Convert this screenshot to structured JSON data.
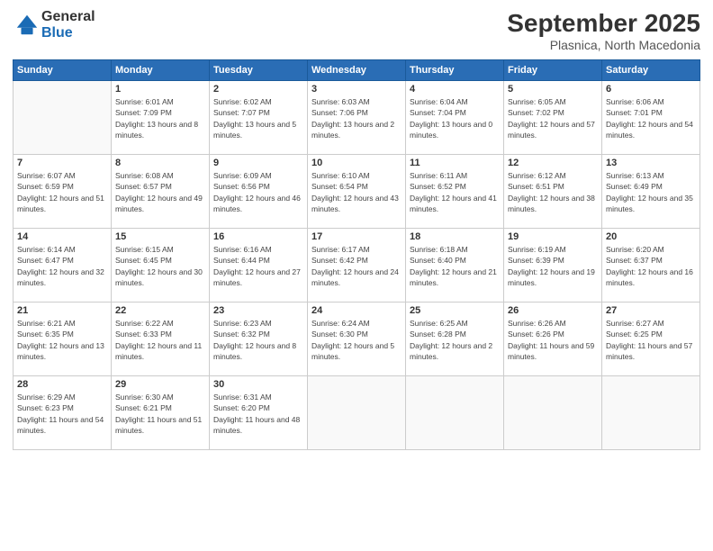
{
  "logo": {
    "general": "General",
    "blue": "Blue"
  },
  "header": {
    "month": "September 2025",
    "location": "Plasnica, North Macedonia"
  },
  "weekdays": [
    "Sunday",
    "Monday",
    "Tuesday",
    "Wednesday",
    "Thursday",
    "Friday",
    "Saturday"
  ],
  "weeks": [
    [
      {
        "day": "",
        "sunrise": "",
        "sunset": "",
        "daylight": ""
      },
      {
        "day": "1",
        "sunrise": "Sunrise: 6:01 AM",
        "sunset": "Sunset: 7:09 PM",
        "daylight": "Daylight: 13 hours and 8 minutes."
      },
      {
        "day": "2",
        "sunrise": "Sunrise: 6:02 AM",
        "sunset": "Sunset: 7:07 PM",
        "daylight": "Daylight: 13 hours and 5 minutes."
      },
      {
        "day": "3",
        "sunrise": "Sunrise: 6:03 AM",
        "sunset": "Sunset: 7:06 PM",
        "daylight": "Daylight: 13 hours and 2 minutes."
      },
      {
        "day": "4",
        "sunrise": "Sunrise: 6:04 AM",
        "sunset": "Sunset: 7:04 PM",
        "daylight": "Daylight: 13 hours and 0 minutes."
      },
      {
        "day": "5",
        "sunrise": "Sunrise: 6:05 AM",
        "sunset": "Sunset: 7:02 PM",
        "daylight": "Daylight: 12 hours and 57 minutes."
      },
      {
        "day": "6",
        "sunrise": "Sunrise: 6:06 AM",
        "sunset": "Sunset: 7:01 PM",
        "daylight": "Daylight: 12 hours and 54 minutes."
      }
    ],
    [
      {
        "day": "7",
        "sunrise": "Sunrise: 6:07 AM",
        "sunset": "Sunset: 6:59 PM",
        "daylight": "Daylight: 12 hours and 51 minutes."
      },
      {
        "day": "8",
        "sunrise": "Sunrise: 6:08 AM",
        "sunset": "Sunset: 6:57 PM",
        "daylight": "Daylight: 12 hours and 49 minutes."
      },
      {
        "day": "9",
        "sunrise": "Sunrise: 6:09 AM",
        "sunset": "Sunset: 6:56 PM",
        "daylight": "Daylight: 12 hours and 46 minutes."
      },
      {
        "day": "10",
        "sunrise": "Sunrise: 6:10 AM",
        "sunset": "Sunset: 6:54 PM",
        "daylight": "Daylight: 12 hours and 43 minutes."
      },
      {
        "day": "11",
        "sunrise": "Sunrise: 6:11 AM",
        "sunset": "Sunset: 6:52 PM",
        "daylight": "Daylight: 12 hours and 41 minutes."
      },
      {
        "day": "12",
        "sunrise": "Sunrise: 6:12 AM",
        "sunset": "Sunset: 6:51 PM",
        "daylight": "Daylight: 12 hours and 38 minutes."
      },
      {
        "day": "13",
        "sunrise": "Sunrise: 6:13 AM",
        "sunset": "Sunset: 6:49 PM",
        "daylight": "Daylight: 12 hours and 35 minutes."
      }
    ],
    [
      {
        "day": "14",
        "sunrise": "Sunrise: 6:14 AM",
        "sunset": "Sunset: 6:47 PM",
        "daylight": "Daylight: 12 hours and 32 minutes."
      },
      {
        "day": "15",
        "sunrise": "Sunrise: 6:15 AM",
        "sunset": "Sunset: 6:45 PM",
        "daylight": "Daylight: 12 hours and 30 minutes."
      },
      {
        "day": "16",
        "sunrise": "Sunrise: 6:16 AM",
        "sunset": "Sunset: 6:44 PM",
        "daylight": "Daylight: 12 hours and 27 minutes."
      },
      {
        "day": "17",
        "sunrise": "Sunrise: 6:17 AM",
        "sunset": "Sunset: 6:42 PM",
        "daylight": "Daylight: 12 hours and 24 minutes."
      },
      {
        "day": "18",
        "sunrise": "Sunrise: 6:18 AM",
        "sunset": "Sunset: 6:40 PM",
        "daylight": "Daylight: 12 hours and 21 minutes."
      },
      {
        "day": "19",
        "sunrise": "Sunrise: 6:19 AM",
        "sunset": "Sunset: 6:39 PM",
        "daylight": "Daylight: 12 hours and 19 minutes."
      },
      {
        "day": "20",
        "sunrise": "Sunrise: 6:20 AM",
        "sunset": "Sunset: 6:37 PM",
        "daylight": "Daylight: 12 hours and 16 minutes."
      }
    ],
    [
      {
        "day": "21",
        "sunrise": "Sunrise: 6:21 AM",
        "sunset": "Sunset: 6:35 PM",
        "daylight": "Daylight: 12 hours and 13 minutes."
      },
      {
        "day": "22",
        "sunrise": "Sunrise: 6:22 AM",
        "sunset": "Sunset: 6:33 PM",
        "daylight": "Daylight: 12 hours and 11 minutes."
      },
      {
        "day": "23",
        "sunrise": "Sunrise: 6:23 AM",
        "sunset": "Sunset: 6:32 PM",
        "daylight": "Daylight: 12 hours and 8 minutes."
      },
      {
        "day": "24",
        "sunrise": "Sunrise: 6:24 AM",
        "sunset": "Sunset: 6:30 PM",
        "daylight": "Daylight: 12 hours and 5 minutes."
      },
      {
        "day": "25",
        "sunrise": "Sunrise: 6:25 AM",
        "sunset": "Sunset: 6:28 PM",
        "daylight": "Daylight: 12 hours and 2 minutes."
      },
      {
        "day": "26",
        "sunrise": "Sunrise: 6:26 AM",
        "sunset": "Sunset: 6:26 PM",
        "daylight": "Daylight: 11 hours and 59 minutes."
      },
      {
        "day": "27",
        "sunrise": "Sunrise: 6:27 AM",
        "sunset": "Sunset: 6:25 PM",
        "daylight": "Daylight: 11 hours and 57 minutes."
      }
    ],
    [
      {
        "day": "28",
        "sunrise": "Sunrise: 6:29 AM",
        "sunset": "Sunset: 6:23 PM",
        "daylight": "Daylight: 11 hours and 54 minutes."
      },
      {
        "day": "29",
        "sunrise": "Sunrise: 6:30 AM",
        "sunset": "Sunset: 6:21 PM",
        "daylight": "Daylight: 11 hours and 51 minutes."
      },
      {
        "day": "30",
        "sunrise": "Sunrise: 6:31 AM",
        "sunset": "Sunset: 6:20 PM",
        "daylight": "Daylight: 11 hours and 48 minutes."
      },
      {
        "day": "",
        "sunrise": "",
        "sunset": "",
        "daylight": ""
      },
      {
        "day": "",
        "sunrise": "",
        "sunset": "",
        "daylight": ""
      },
      {
        "day": "",
        "sunrise": "",
        "sunset": "",
        "daylight": ""
      },
      {
        "day": "",
        "sunrise": "",
        "sunset": "",
        "daylight": ""
      }
    ]
  ]
}
